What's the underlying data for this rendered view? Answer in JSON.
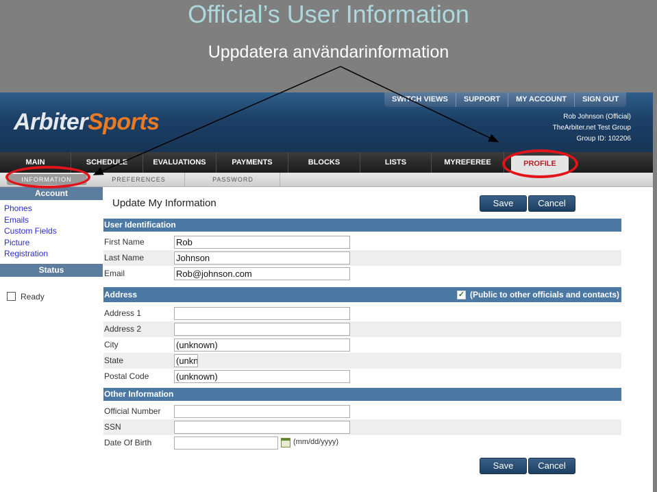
{
  "slide": {
    "title": "Official’s User Information",
    "subtitle": "Uppdatera användarinformation"
  },
  "header": {
    "logo_part1": "Arbiter",
    "logo_part2": "Sports",
    "top_buttons": [
      "SWITCH VIEWS",
      "SUPPORT",
      "MY ACCOUNT",
      "SIGN OUT"
    ],
    "user_name": "Rob Johnson (Official)",
    "group_name": "TheArbiter.net Test Group",
    "group_id": "Group ID: 102206"
  },
  "nav": {
    "tabs": [
      "MAIN",
      "SCHEDULE",
      "EVALUATIONS",
      "PAYMENTS",
      "BLOCKS",
      "LISTS",
      "MYREFEREE",
      "PROFILE"
    ],
    "active": "PROFILE"
  },
  "subnav": {
    "tabs": [
      "INFORMATION",
      "PREFERENCES",
      "PASSWORD"
    ],
    "active": "INFORMATION"
  },
  "sidebar": {
    "account_heading": "Account",
    "links": [
      "Phones",
      "Emails",
      "Custom Fields",
      "Picture",
      "Registration"
    ],
    "status_heading": "Status",
    "status_item": "Ready"
  },
  "main": {
    "title": "Update My Information",
    "save_label": "Save",
    "cancel_label": "Cancel",
    "sections": {
      "identification": "User Identification",
      "address": "Address",
      "public_label": "(Public to other officials and contacts)",
      "public_checked": true,
      "other": "Other Information"
    },
    "fields": {
      "first_name_label": "First Name",
      "first_name": "Rob",
      "last_name_label": "Last Name",
      "last_name": "Johnson",
      "email_label": "Email",
      "email": "Rob@johnson.com",
      "address1_label": "Address 1",
      "address1": "",
      "address2_label": "Address 2",
      "address2": "",
      "city_label": "City",
      "city": "(unknown)",
      "state_label": "State",
      "state": "(unkn",
      "postal_label": "Postal Code",
      "postal": "(unknown)",
      "official_number_label": "Official Number",
      "official_number": "",
      "ssn_label": "SSN",
      "ssn": "",
      "dob_label": "Date Of Birth",
      "dob": "",
      "dob_format": "(mm/dd/yyyy)"
    }
  },
  "colors": {
    "highlight_ring": "#e0141a",
    "section_bar": "#4b79a4",
    "button": "#1d3f63"
  }
}
